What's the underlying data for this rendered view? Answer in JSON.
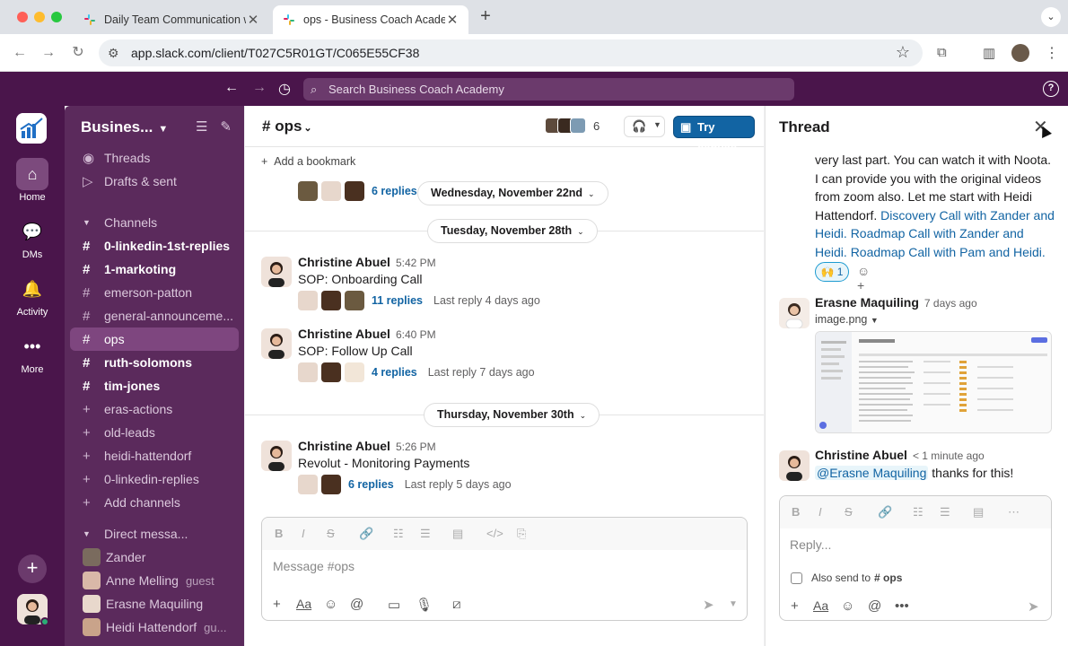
{
  "browser": {
    "tabs": [
      {
        "title": "Daily Team Communication w",
        "active": false
      },
      {
        "title": "ops - Business Coach Acade",
        "active": true
      }
    ],
    "url": "app.slack.com/client/T027C5R01GT/C065E55CF38"
  },
  "slack": {
    "search_placeholder": "Search Business Coach Academy",
    "rail": [
      {
        "label": "Home"
      },
      {
        "label": "DMs"
      },
      {
        "label": "Activity"
      },
      {
        "label": "More"
      }
    ],
    "workspace_name": "Busines...",
    "sidebar": {
      "top_items": [
        "Threads",
        "Drafts & sent"
      ],
      "channels_header": "Channels",
      "channels": [
        {
          "name": "0-linkedin-1st-replies",
          "bold": true
        },
        {
          "name": "1-markoting",
          "bold": true
        },
        {
          "name": "emerson-patton",
          "bold": false
        },
        {
          "name": "general-announceme...",
          "bold": false
        },
        {
          "name": "ops",
          "bold": false,
          "selected": true
        },
        {
          "name": "ruth-solomons",
          "bold": true
        },
        {
          "name": "tim-jones",
          "bold": true
        }
      ],
      "join_channels": [
        "eras-actions",
        "old-leads",
        "heidi-hattendorf",
        "0-linkedin-replies"
      ],
      "add_channels": "Add channels",
      "dm_header": "Direct messa...",
      "dms": [
        {
          "name": "Zander",
          "tag": ""
        },
        {
          "name": "Anne Melling",
          "tag": "guest"
        },
        {
          "name": "Erasne Maquiling",
          "tag": ""
        },
        {
          "name": "Heidi Hattendorf",
          "tag": "gu..."
        }
      ]
    },
    "channel": {
      "name": "ops",
      "member_count": "6",
      "try_canvas": "Try canvas",
      "add_bookmark": "Add a bookmark",
      "top_replies": "6 replies",
      "day_dividers": [
        "Wednesday, November 22nd",
        "Tuesday, November 28th",
        "Thursday, November 30th"
      ],
      "messages": [
        {
          "author": "Christine Abuel",
          "time": "5:42 PM",
          "text": "SOP: Onboarding Call",
          "replies": "11 replies",
          "last": "Last reply 4 days ago"
        },
        {
          "author": "Christine Abuel",
          "time": "6:40 PM",
          "text": "SOP: Follow Up Call",
          "replies": "4 replies",
          "last": "Last reply 7 days ago"
        },
        {
          "author": "Christine Abuel",
          "time": "5:26 PM",
          "text": "Revolut - Monitoring Payments",
          "replies": "6 replies",
          "last": "Last reply 5 days ago"
        }
      ],
      "composer_placeholder": "Message #ops"
    },
    "thread": {
      "title": "Thread",
      "body_text": "very last part. You can watch it with Noota. I can provide you with the original videos from zoom also. Let me start with Heidi Hattendorf. ",
      "links": [
        "Discovery Call with Zander and Heidi.",
        "Roadmap Call with Zander and Heidi.",
        "Roadmap Call with Pam and Heidi."
      ],
      "reaction_count": "1",
      "reply1": {
        "author": "Erasne Maquiling",
        "time": "7 days ago",
        "file": "image.png"
      },
      "reply2": {
        "author": "Christine Abuel",
        "time": "1 minute ago",
        "mention": "@Erasne Maquiling",
        "text": " thanks for this!"
      },
      "composer_placeholder": "Reply...",
      "also_send": "Also send to",
      "also_channel": "# ops"
    }
  }
}
